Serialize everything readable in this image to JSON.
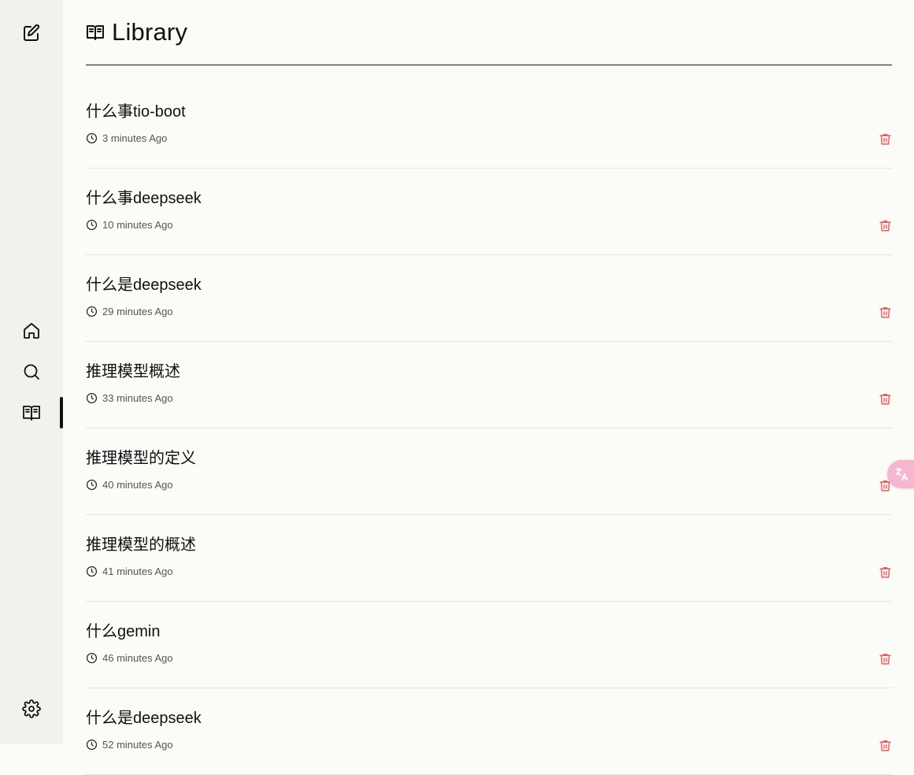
{
  "page": {
    "title": "Library",
    "accent_color": "#111111",
    "delete_color": "#e45a5a"
  },
  "sidebar": {
    "items": [
      {
        "name": "new-note",
        "icon": "edit-icon"
      },
      {
        "name": "home",
        "icon": "home-icon"
      },
      {
        "name": "search",
        "icon": "search-icon"
      },
      {
        "name": "library",
        "icon": "book-open-icon",
        "active": true
      },
      {
        "name": "settings",
        "icon": "gear-icon"
      }
    ]
  },
  "library": {
    "items": [
      {
        "title": "什么事tio-boot",
        "time": "3 minutes Ago"
      },
      {
        "title": "什么事deepseek",
        "time": "10 minutes Ago"
      },
      {
        "title": "什么是deepseek",
        "time": "29 minutes Ago"
      },
      {
        "title": "推理模型概述",
        "time": "33 minutes Ago"
      },
      {
        "title": "推理模型的定义",
        "time": "40 minutes Ago"
      },
      {
        "title": "推理模型的概述",
        "time": "41 minutes Ago"
      },
      {
        "title": "什么gemin",
        "time": "46 minutes Ago"
      },
      {
        "title": "什么是deepseek",
        "time": "52 minutes Ago"
      }
    ]
  },
  "translate_widget": {
    "icon": "translate-icon"
  }
}
